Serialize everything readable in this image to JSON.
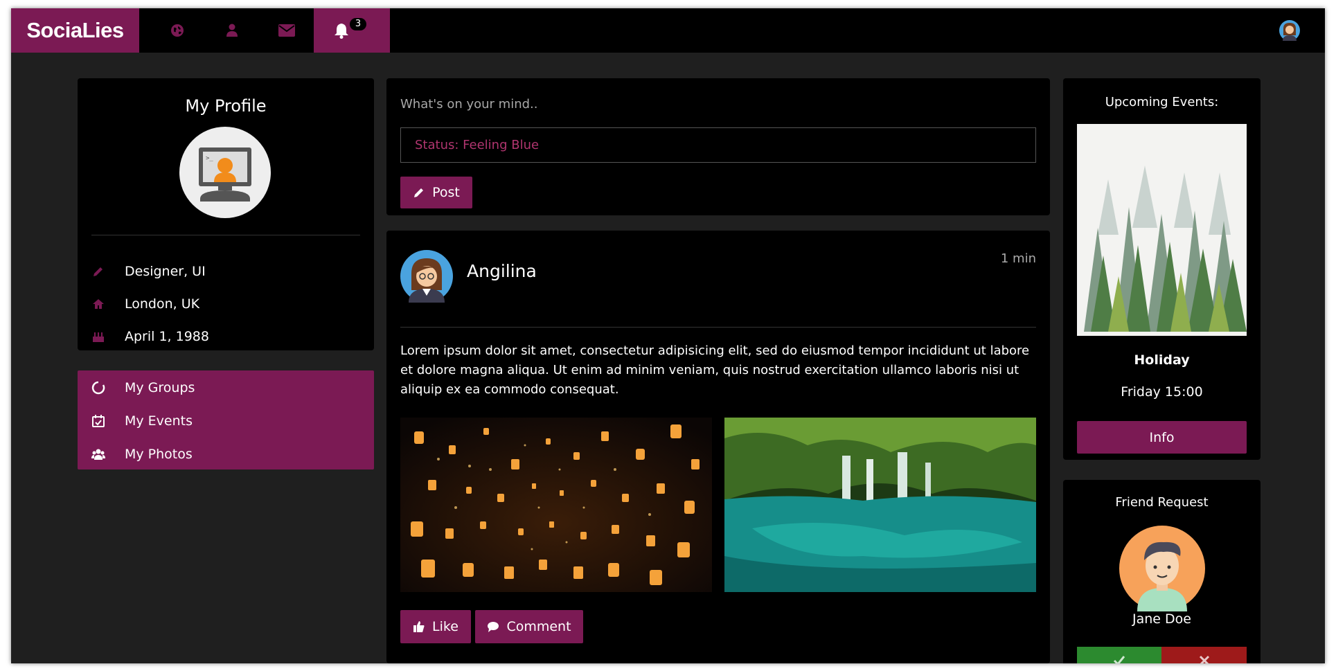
{
  "nav": {
    "brand": "SociaLies",
    "notification_count": "3"
  },
  "profile": {
    "title": "My Profile",
    "job": "Designer, UI",
    "location": "London, UK",
    "birthday": "April 1, 1988"
  },
  "menu": {
    "groups": "My Groups",
    "events": "My Events",
    "photos": "My Photos"
  },
  "composer": {
    "prompt": "What's on your mind..",
    "status_value": "Status: Feeling Blue",
    "post_label": "Post"
  },
  "post": {
    "author": "Angilina",
    "time": "1 min",
    "text": "Lorem ipsum dolor sit amet, consectetur adipisicing elit, sed do eiusmod tempor incididunt ut labore et dolore magna aliqua. Ut enim ad minim veniam, quis nostrud exercitation ullamco laboris nisi ut aliquip ex ea commodo consequat.",
    "like_label": "Like",
    "comment_label": "Comment"
  },
  "events": {
    "heading": "Upcoming Events:",
    "event_name": "Holiday",
    "event_time": "Friday 15:00",
    "info_label": "Info"
  },
  "friend_request": {
    "heading": "Friend Request",
    "name": "Jane Doe"
  },
  "colors": {
    "accent": "#7b1a54",
    "accept": "#2c8a2f",
    "decline": "#9e1a1a"
  }
}
